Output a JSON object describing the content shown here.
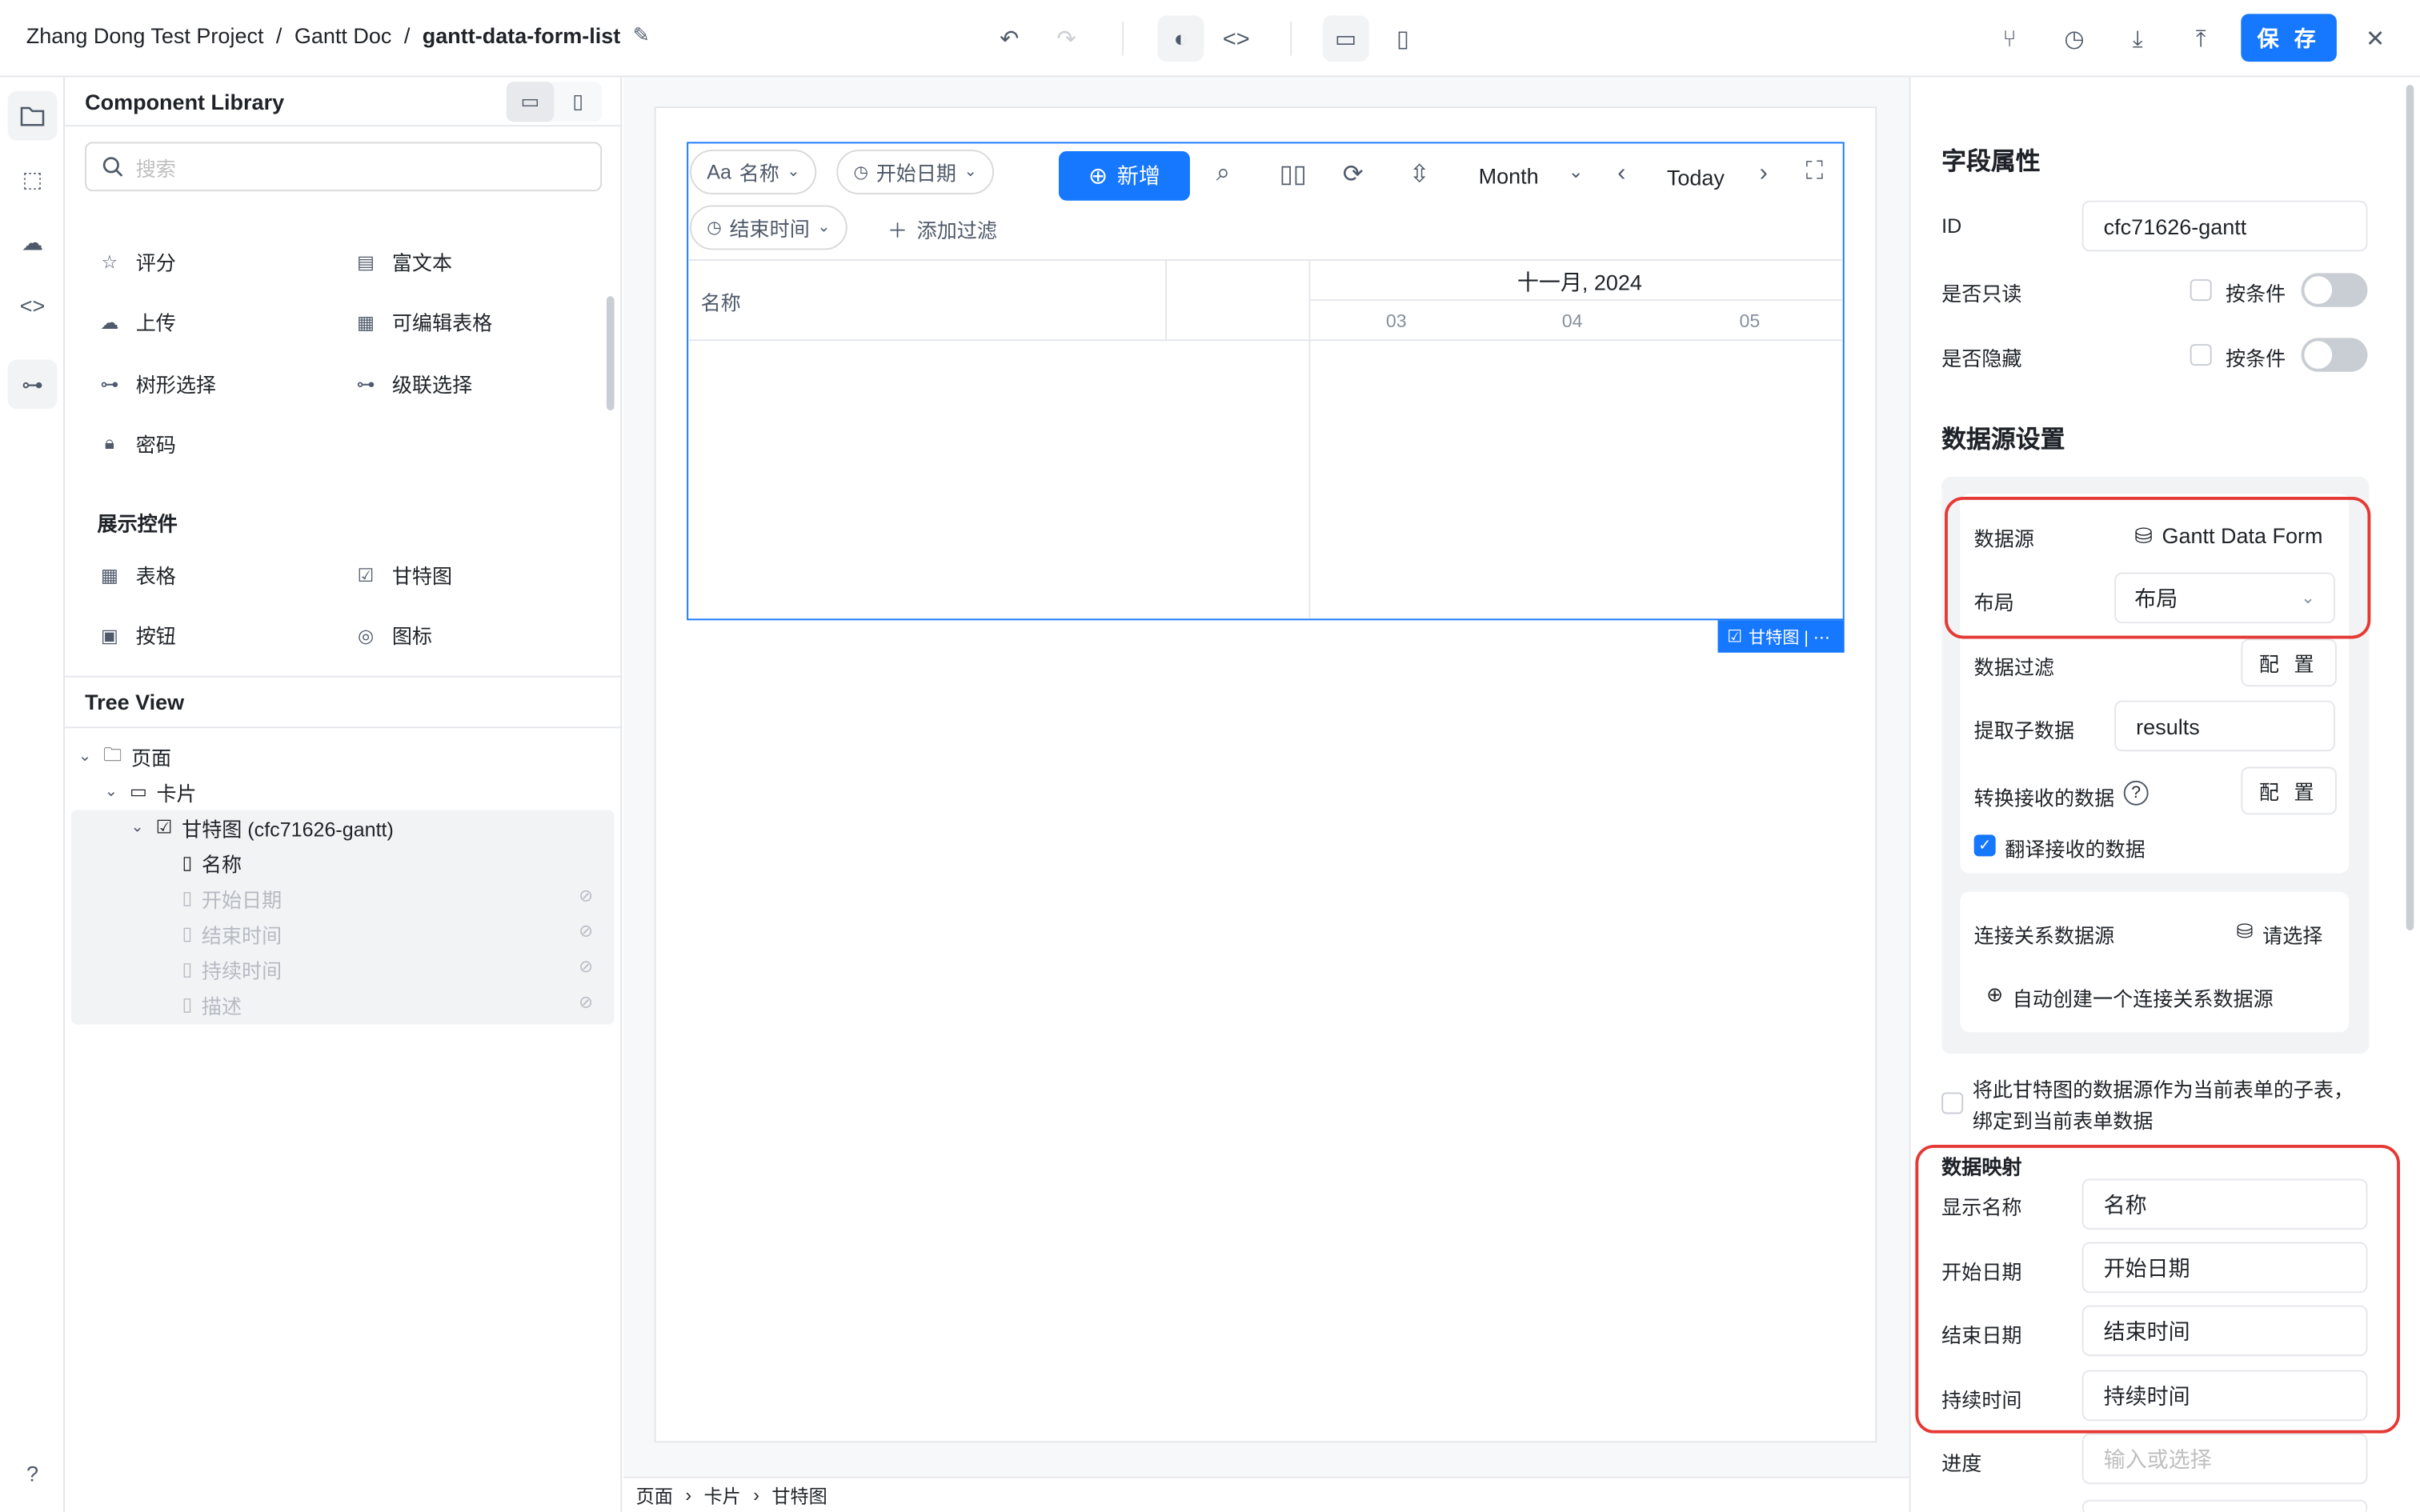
{
  "topbar": {
    "project": "Zhang Dong Test Project",
    "doc": "Gantt Doc",
    "page": "gantt-data-form-list",
    "save_label": "保 存"
  },
  "library": {
    "title": "Component Library",
    "search_placeholder": "搜索",
    "components": [
      {
        "label": "评分",
        "icon": "star-icon"
      },
      {
        "label": "富文本",
        "icon": "rich-text-icon"
      },
      {
        "label": "上传",
        "icon": "upload-cloud-icon"
      },
      {
        "label": "可编辑表格",
        "icon": "table-icon"
      },
      {
        "label": "树形选择",
        "icon": "tree-icon"
      },
      {
        "label": "级联选择",
        "icon": "cascade-icon"
      },
      {
        "label": "密码",
        "icon": "lock-icon"
      }
    ],
    "display_section": "展示控件",
    "display_components": [
      {
        "label": "表格",
        "icon": "table-icon"
      },
      {
        "label": "甘特图",
        "icon": "gantt-icon"
      },
      {
        "label": "按钮",
        "icon": "button-icon"
      },
      {
        "label": "图标",
        "icon": "palette-icon"
      }
    ]
  },
  "tree": {
    "title": "Tree View",
    "nodes": [
      {
        "label": "页面"
      },
      {
        "label": "卡片"
      },
      {
        "label": "甘特图 (cfc71626-gantt)"
      },
      {
        "label": "名称"
      },
      {
        "label": "开始日期"
      },
      {
        "label": "结束时间"
      },
      {
        "label": "持续时间"
      },
      {
        "label": "描述"
      }
    ]
  },
  "gantt": {
    "chip_name": "名称",
    "chip_name_prefix": "Aa",
    "chip_start": "开始日期",
    "chip_end": "结束时间",
    "add_filter": "添加过滤",
    "add_button": "新增",
    "view_mode": "Month",
    "today": "Today",
    "col_name": "名称",
    "month_label": "十一月, 2024",
    "days": [
      "03",
      "04",
      "05"
    ],
    "tag_label": "甘特图 | ⋯"
  },
  "bottom_breadcrumb": [
    "页面",
    "卡片",
    "甘特图"
  ],
  "props": {
    "title": "字段属性",
    "id_label": "ID",
    "id_value": "cfc71626-gantt",
    "readonly_label": "是否只读",
    "hidden_label": "是否隐藏",
    "condition_label": "按条件",
    "ds_title": "数据源设置",
    "ds_label": "数据源",
    "ds_value": "Gantt Data Form",
    "layout_label": "布局",
    "layout_value": "布局",
    "filter_label": "数据过滤",
    "config_label": "配 置",
    "extract_label": "提取子数据",
    "extract_value": "results",
    "transform_label": "转换接收的数据",
    "translate_label": "翻译接收的数据",
    "rel_label": "连接关系数据源",
    "rel_value": "请选择",
    "auto_create_label": "自动创建一个连接关系数据源",
    "subtable_label": "将此甘特图的数据源作为当前表单的子表，绑定到当前表单数据",
    "mapping_title": "数据映射",
    "map_display_label": "显示名称",
    "map_display_value": "名称",
    "map_start_label": "开始日期",
    "map_start_value": "开始日期",
    "map_end_label": "结束日期",
    "map_end_value": "结束时间",
    "map_duration_label": "持续时间",
    "map_duration_value": "持续时间",
    "map_progress_label": "进度",
    "map_progress_placeholder": "输入或选择"
  },
  "colors": {
    "accent": "#1677ff",
    "highlight": "#e53935"
  }
}
